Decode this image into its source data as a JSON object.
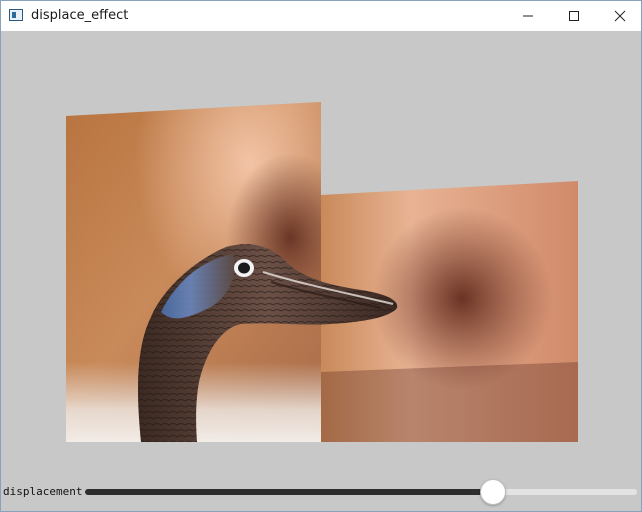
{
  "window": {
    "title": "displace_effect",
    "icon": "app-window-icon",
    "controls": [
      "minimize-icon",
      "maximize-icon",
      "close-icon"
    ]
  },
  "colors": {
    "background": "#c8c8c8",
    "slider_fill": "#2d2d2d",
    "slider_track": "#e3e3e3"
  },
  "image": {
    "description_icon": "displaced-photo-bird"
  },
  "control": {
    "label": "displacement",
    "value_fraction": 0.74
  }
}
